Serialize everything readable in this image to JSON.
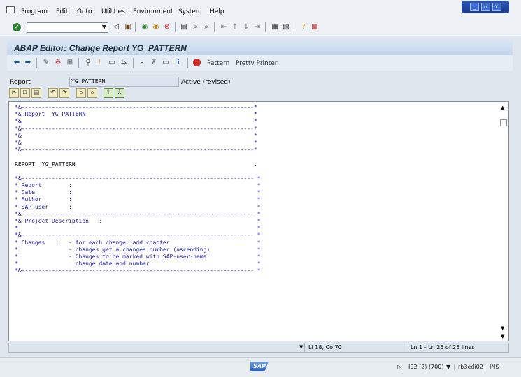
{
  "menu": {
    "items": [
      "Program",
      "Edit",
      "Goto",
      "Utilities",
      "Environment",
      "System",
      "Help"
    ]
  },
  "window_controls": {
    "minimize": "_",
    "restore": "▫",
    "close": "x"
  },
  "toolbar": {
    "command_field_value": "",
    "ok_glyph": "✔"
  },
  "title": "ABAP Editor: Change Report YG_PATTERN",
  "app_toolbar": {
    "pattern_label": "Pattern",
    "pretty_printer_label": "Pretty Printer"
  },
  "report": {
    "label": "Report",
    "name": "YG_PATTERN",
    "status": "Active (revised)"
  },
  "code_lines": [
    "*&---------------------------------------------------------------------*",
    "*& Report  YG_PATTERN                                                  *",
    "*&                                                                     *",
    "*&---------------------------------------------------------------------*",
    "*&                                                                     *",
    "*&                                                                     *",
    "*&---------------------------------------------------------------------*",
    "",
    "REPORT  YG_PATTERN                                                     .",
    "",
    "*&--------------------------------------------------------------------- *",
    "* Report        :                                                       *",
    "* Date          :                                                       *",
    "* Author        :                                                       *",
    "* SAP user      :                                                       *",
    "*&--------------------------------------------------------------------- *",
    "*& Project Description   :                                              *",
    "*                                                                       *",
    "*&--------------------------------------------------------------------- *",
    "* Changes   :   - for each change: add chapter                          *",
    "*               - changes get a changes number (ascending)              *",
    "*               - Changes to be marked with SAP-user-name               *",
    "*                 change date and number                                *",
    "*&--------------------------------------------------------------------- *"
  ],
  "editor_status": {
    "position": "Li 18, Co 70",
    "lines": "Ln 1 - Ln 25 of 25 lines"
  },
  "system_status": {
    "logo": "SAP",
    "session": "I02 (2) (700)",
    "server": "rb3edi02",
    "mode": "INS"
  }
}
